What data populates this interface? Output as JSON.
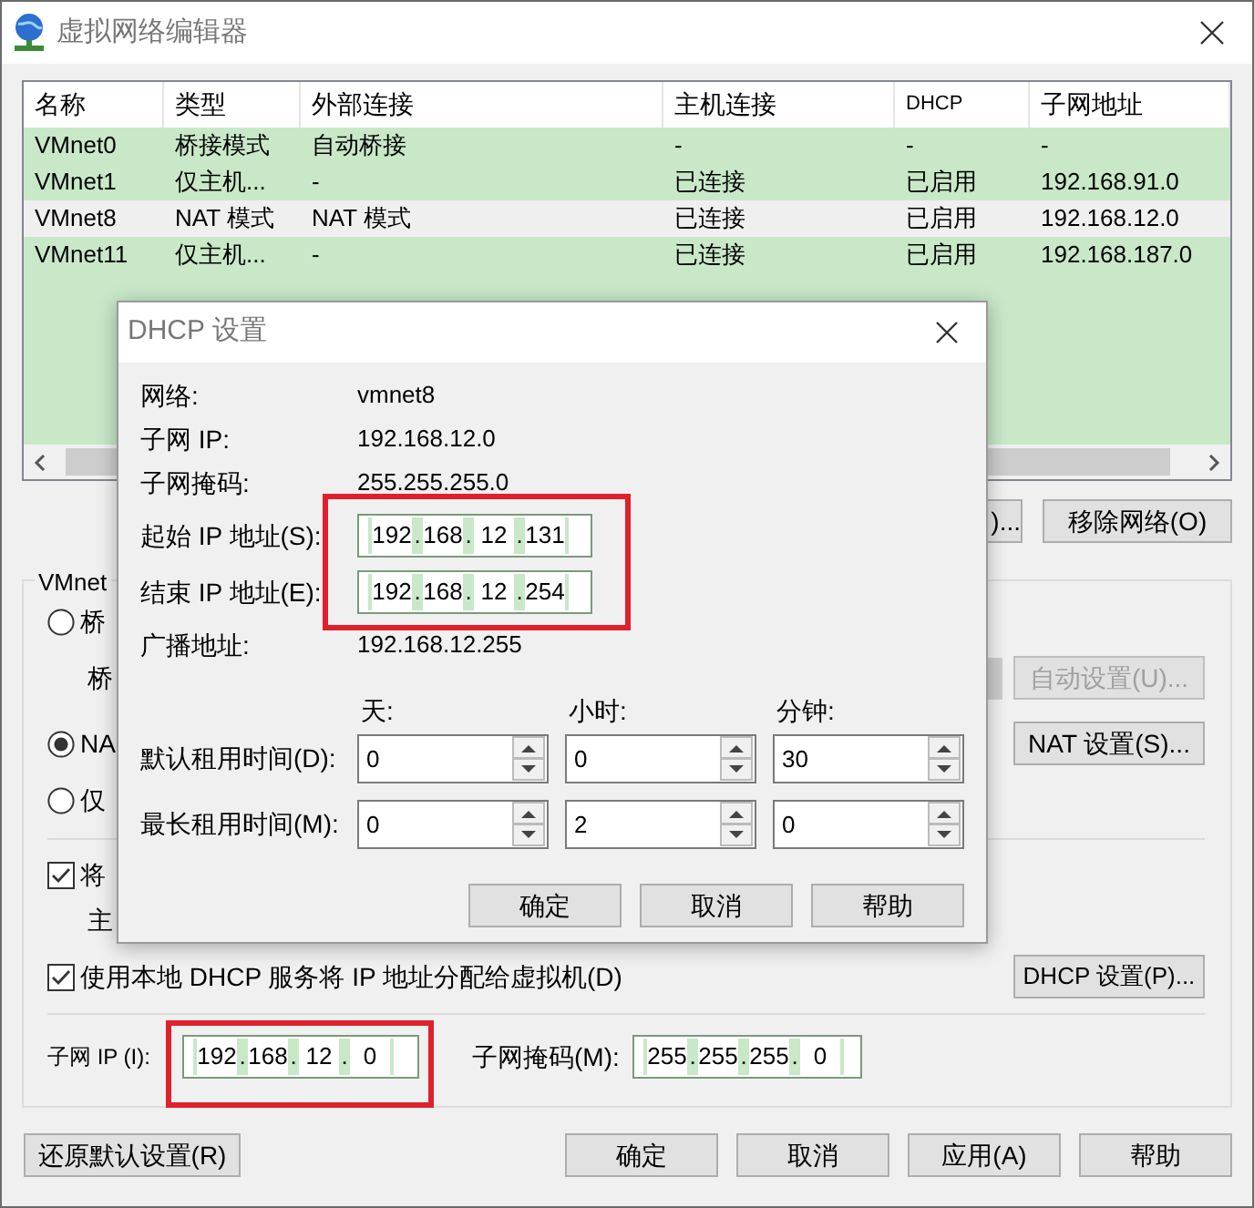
{
  "window": {
    "title": "虚拟网络编辑器"
  },
  "table": {
    "columns": [
      "名称",
      "类型",
      "外部连接",
      "主机连接",
      "DHCP",
      "子网地址"
    ],
    "rows": [
      {
        "cells": [
          "VMnet0",
          "桥接模式",
          "自动桥接",
          "-",
          "-",
          "-"
        ],
        "selected": false
      },
      {
        "cells": [
          "VMnet1",
          "仅主机...",
          "-",
          "已连接",
          "已启用",
          "192.168.91.0"
        ],
        "selected": false
      },
      {
        "cells": [
          "VMnet8",
          "NAT 模式",
          "NAT 模式",
          "已连接",
          "已启用",
          "192.168.12.0"
        ],
        "selected": true
      },
      {
        "cells": [
          "VMnet11",
          "仅主机...",
          "-",
          "已连接",
          "已启用",
          "192.168.187.0"
        ],
        "selected": false
      }
    ]
  },
  "list_buttons": [
    ")...",
    "移除网络(O)"
  ],
  "vmnet_info": {
    "title": "VMnet",
    "modes": [
      {
        "label": "桥",
        "selected": false
      },
      {
        "label": "NA",
        "selected": true
      },
      {
        "label": "仅",
        "selected": false
      }
    ],
    "bridge_label": "桥",
    "auto_button": {
      "label": "自动设置(U)...",
      "disabled": true
    },
    "nat_button": "NAT 设置(S)...",
    "host_adapter": {
      "label": "将",
      "checked": true
    },
    "host_label": "主",
    "dhcp": {
      "label": "使用本地 DHCP 服务将 IP 地址分配给虚拟机(D)",
      "checked": true
    },
    "dhcp_button": "DHCP 设置(P)...",
    "subnet_ip": {
      "label": "子网 IP (I):",
      "octets": [
        "192",
        "168",
        "12",
        "0"
      ],
      "separator": "."
    },
    "subnet_mask": {
      "label": "子网掩码(M):",
      "octets": [
        "255",
        "255",
        "255",
        "0"
      ],
      "separator": "."
    }
  },
  "buttons": [
    "还原默认设置(R)",
    "确定",
    "取消",
    "应用(A)",
    "帮助"
  ],
  "dhcp_dialog": {
    "title": "DHCP 设置",
    "info": [
      {
        "label": "网络:",
        "value": "vmnet8"
      },
      {
        "label": "子网 IP:",
        "value": "192.168.12.0"
      },
      {
        "label": "子网掩码:",
        "value": "255.255.255.0"
      }
    ],
    "start_ip": {
      "label": "起始 IP 地址(S):",
      "octets": [
        "192",
        "168",
        "12",
        "131"
      ],
      "separator": "."
    },
    "end_ip": {
      "label": "结束 IP 地址(E):",
      "octets": [
        "192",
        "168",
        "12",
        "254"
      ],
      "separator": "."
    },
    "broadcast": {
      "label": "广播地址:",
      "value": "192.168.12.255"
    },
    "lease_headers": [
      "天:",
      "小时:",
      "分钟:"
    ],
    "leases": [
      {
        "label": "默认租用时间(D):",
        "values": [
          "0",
          "0",
          "30"
        ]
      },
      {
        "label": "最长租用时间(M):",
        "values": [
          "0",
          "2",
          "0"
        ]
      }
    ],
    "buttons": [
      "确定",
      "取消",
      "帮助"
    ]
  }
}
